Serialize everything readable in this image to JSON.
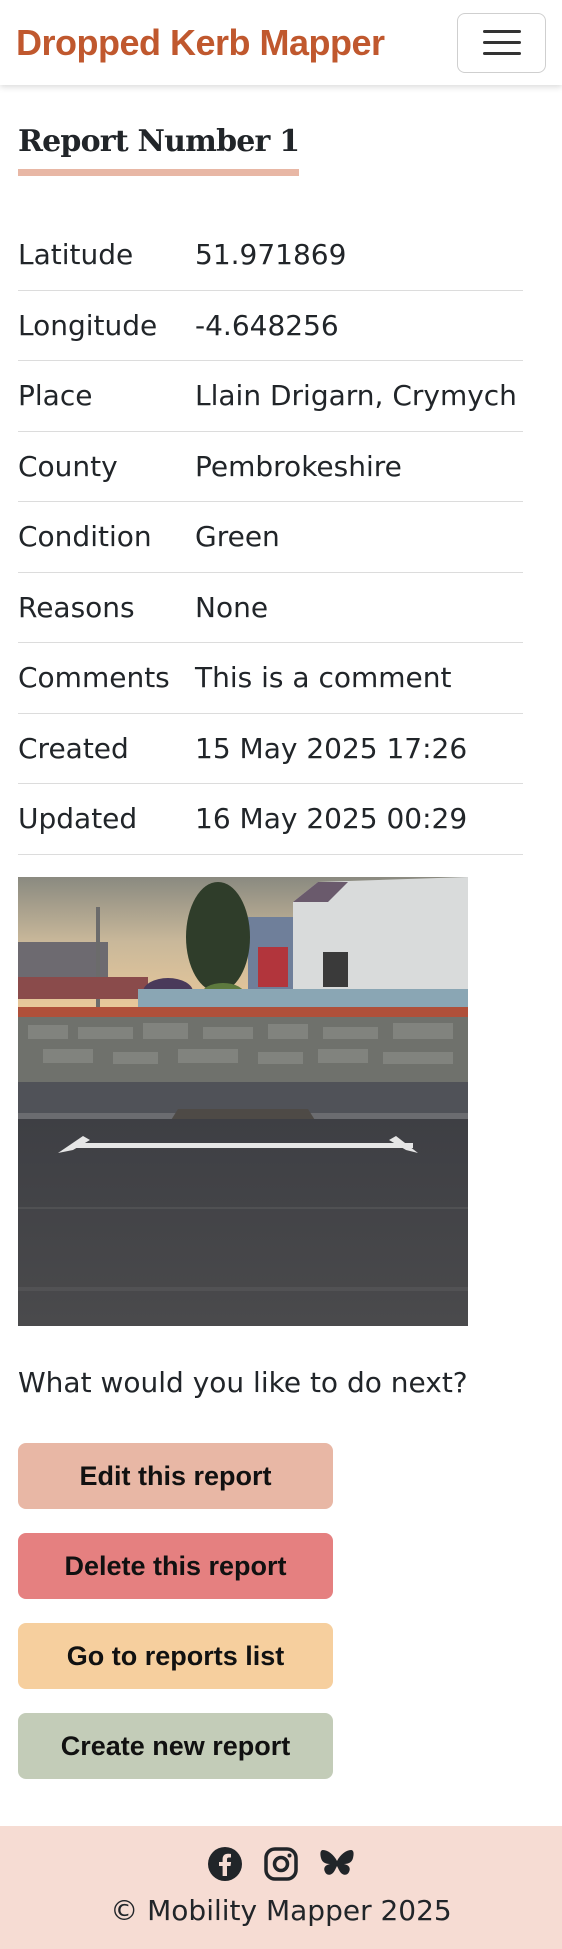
{
  "navbar": {
    "brand": "Dropped Kerb Mapper",
    "menu_icon": "hamburger-menu-icon"
  },
  "report": {
    "title": "Report Number 1",
    "fields": [
      {
        "label": "Latitude",
        "value": "51.971869"
      },
      {
        "label": "Longitude",
        "value": "-4.648256"
      },
      {
        "label": "Place",
        "value": "Llain Drigarn, Crymych"
      },
      {
        "label": "County",
        "value": "Pembrokeshire"
      },
      {
        "label": "Condition",
        "value": "Green"
      },
      {
        "label": "Reasons",
        "value": "None"
      },
      {
        "label": "Comments",
        "value": "This is a comment"
      },
      {
        "label": "Created",
        "value": "15 May 2025 17:26"
      },
      {
        "label": "Updated",
        "value": "16 May 2025 00:29"
      }
    ]
  },
  "next": {
    "prompt": "What would you like to do next?",
    "edit_label": "Edit this report",
    "delete_label": "Delete this report",
    "list_label": "Go to reports list",
    "create_label": "Create new report"
  },
  "footer": {
    "icons": [
      "facebook-icon",
      "instagram-icon",
      "bluesky-icon"
    ],
    "copyright": "© Mobility Mapper 2025"
  },
  "colors": {
    "brand": "#c0582e",
    "accent": "#e8b7a5",
    "danger": "#e58080",
    "warning": "#f6cf9e",
    "neutral": "#c3ccb8",
    "footer_bg": "#f6dcd3"
  }
}
